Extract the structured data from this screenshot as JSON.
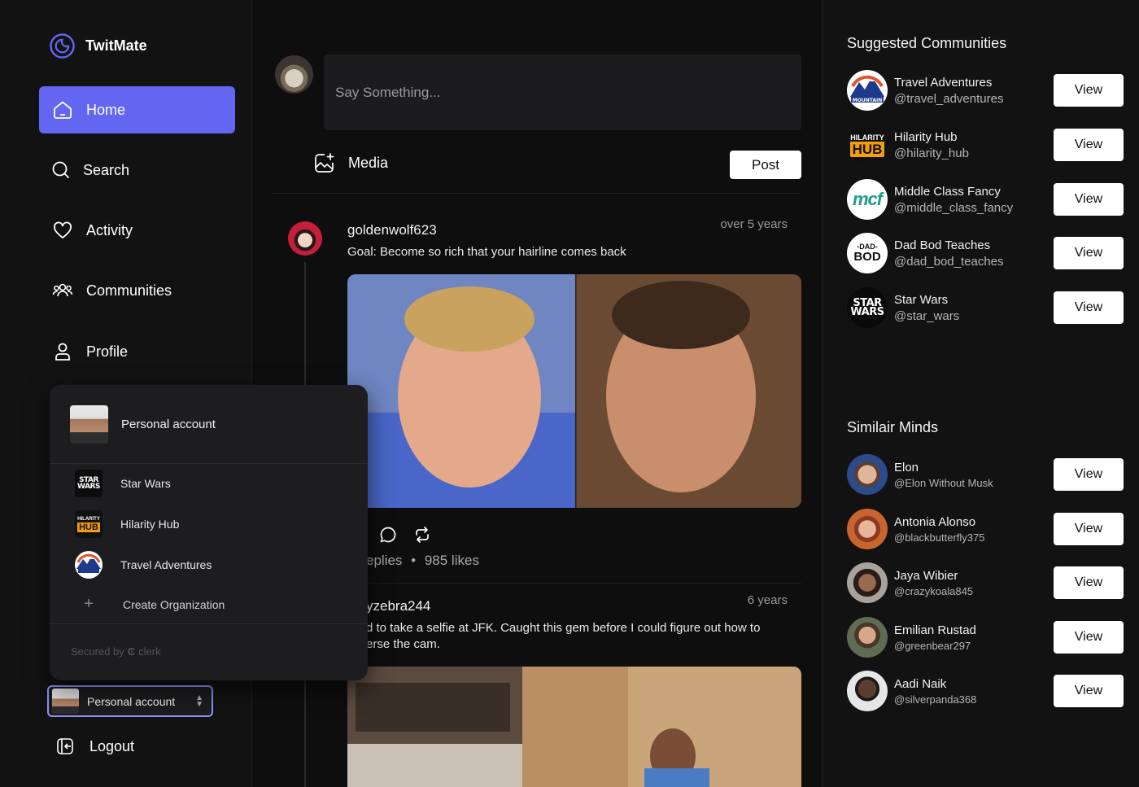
{
  "app": {
    "name": "TwitMate",
    "accent": "#6366f1"
  },
  "nav": [
    {
      "label": "Home",
      "icon": "home-icon",
      "active": true
    },
    {
      "label": "Search",
      "icon": "search-icon"
    },
    {
      "label": "Activity",
      "icon": "heart-icon"
    },
    {
      "label": "Communities",
      "icon": "users-icon"
    },
    {
      "label": "Profile",
      "icon": "user-icon"
    }
  ],
  "org_switcher": {
    "current": "Personal account",
    "orgs": [
      {
        "label": "Star Wars",
        "icon": "star-wars-logo"
      },
      {
        "label": "Hilarity Hub",
        "icon": "hilarity-hub-logo"
      },
      {
        "label": "Travel Adventures",
        "icon": "mountain-logo"
      }
    ],
    "create_label": "Create Organization",
    "secured_by": "Secured by",
    "secured_brand": "clerk"
  },
  "account_button": {
    "label": "Personal account"
  },
  "logout": {
    "label": "Logout"
  },
  "composer": {
    "placeholder": "Say Something...",
    "media_label": "Media",
    "post_label": "Post"
  },
  "posts": [
    {
      "user": "goldenwolf623",
      "time": "over 5 years",
      "text": "Goal: Become so rich that your hairline comes back",
      "meta_replies": "eplies",
      "meta_sep": "•",
      "meta_likes": "985 likes"
    },
    {
      "user": "yzebra244",
      "time": "6 years",
      "text_line1": "d to take a selfie at JFK. Caught this gem before I could figure out how to",
      "text_line2": "erse the cam."
    }
  ],
  "suggested": {
    "heading": "Suggested Communities",
    "items": [
      {
        "name": "Travel Adventures",
        "handle": "@travel_adventures",
        "icon": "mountain-logo"
      },
      {
        "name": "Hilarity Hub",
        "handle": "@hilarity_hub",
        "icon": "hilarity-hub-logo"
      },
      {
        "name": "Middle Class Fancy",
        "handle": "@middle_class_fancy",
        "icon": "mcf-logo",
        "logo_text": "mcf"
      },
      {
        "name": "Dad Bod Teaches",
        "handle": "@dad_bod_teaches",
        "icon": "dad-bod-logo",
        "logo_text_top": "-DAD-",
        "logo_text_bottom": "BOD"
      },
      {
        "name": "Star Wars",
        "handle": "@star_wars",
        "icon": "star-wars-logo"
      }
    ],
    "view_label": "View"
  },
  "similar": {
    "heading": "Similair Minds",
    "items": [
      {
        "name": "Elon",
        "handle": "@Elon Without Musk"
      },
      {
        "name": "Antonia Alonso",
        "handle": "@blackbutterfly375"
      },
      {
        "name": "Jaya Wibier",
        "handle": "@crazykoala845"
      },
      {
        "name": "Emilian Rustad",
        "handle": "@greenbear297"
      },
      {
        "name": "Aadi Naik",
        "handle": "@silverpanda368"
      }
    ],
    "view_label": "View"
  },
  "logos": {
    "star_wars_line1": "STAR",
    "star_wars_line2": "WARS",
    "hilarity_line1": "HILARITY",
    "hilarity_line2": "HUB",
    "mountain_text": "MOUNTAIN"
  }
}
